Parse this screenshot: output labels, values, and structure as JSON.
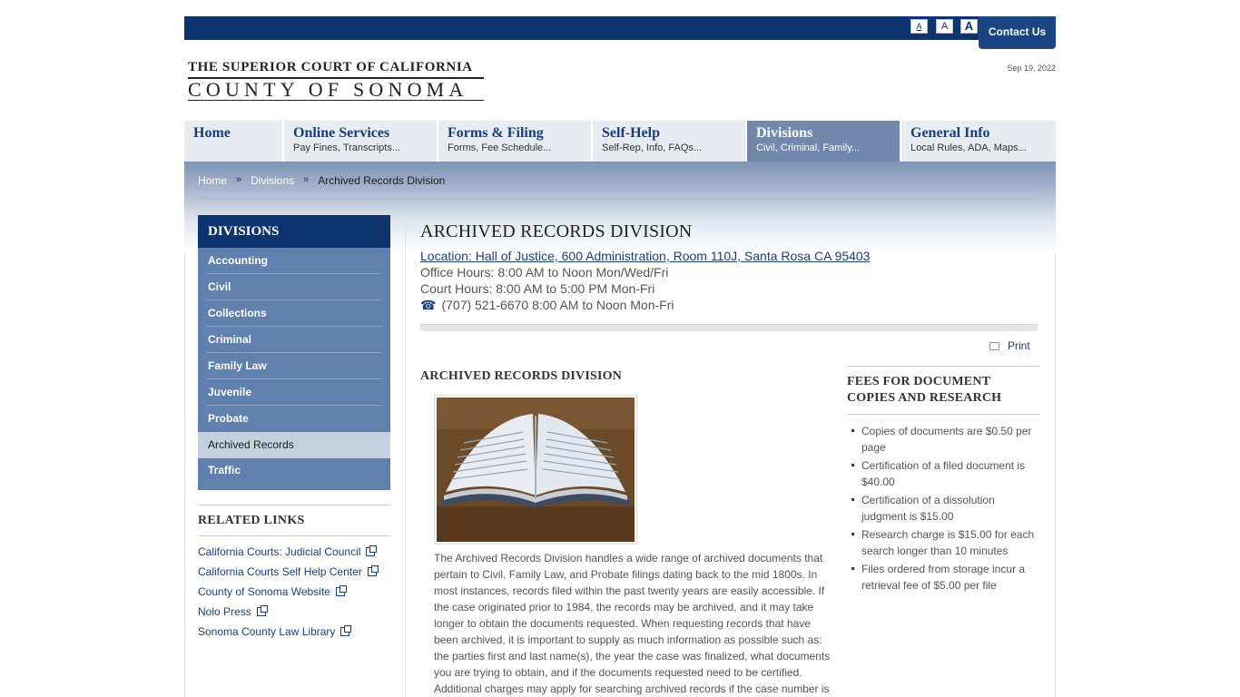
{
  "header": {
    "font_sizes": [
      "A",
      "A",
      "A"
    ],
    "contact_label": "Contact Us",
    "logo_line1": "THE SUPERIOR COURT OF CALIFORNIA",
    "logo_line2": "COUNTY OF SONOMA",
    "date": "Sep 19, 2022"
  },
  "nav": [
    {
      "title": "Home",
      "sub": ""
    },
    {
      "title": "Online Services",
      "sub": "Pay Fines, Transcripts..."
    },
    {
      "title": "Forms & Filing",
      "sub": "Forms, Fee Schedule..."
    },
    {
      "title": "Self-Help",
      "sub": "Self-Rep, Info, FAQs..."
    },
    {
      "title": "Divisions",
      "sub": "Civil, Criminal, Family..."
    },
    {
      "title": "General Info",
      "sub": "Local Rules, ADA, Maps..."
    }
  ],
  "breadcrumb": {
    "home": "Home",
    "sep": "»",
    "divisions": "Divisions",
    "current": "Archived Records Division"
  },
  "sidebar": {
    "heading": "DIVISIONS",
    "items": [
      "Accounting",
      "Civil",
      "Collections",
      "Criminal",
      "Family Law",
      "Juvenile",
      "Probate",
      "Archived Records",
      "Traffic"
    ]
  },
  "related": {
    "heading": "RELATED LINKS",
    "links": [
      "California Courts: Judicial Council",
      "California Courts Self Help Center",
      "County of Sonoma Website",
      "Nolo Press",
      "Sonoma County Law Library"
    ]
  },
  "main": {
    "title": "ARCHIVED RECORDS DIVISION",
    "location": "Location: Hall of Justice, 600 Administration, Room 110J, Santa Rosa CA 95403",
    "office_hours": "Office Hours: 8:00 AM to Noon Mon/Wed/Fri",
    "court_hours": "Court Hours: 8:00 AM to 5:00 PM Mon-Fri",
    "phone": "(707) 521-6670 8:00 AM to Noon Mon-Fri",
    "print_label": "Print",
    "content_title": "ARCHIVED RECORDS DIVISION",
    "paragraph": "The Archived Records Division handles a wide range of archived documents that pertain to Civil, Family Law, and Probate filings dating back to the mid 1800s. In most instances, records filed within the past twenty years are easily accessible. If the case originated prior to 1984, the records may be archived, and it may take longer to obtain the documents requested. When requesting records that have been archived, it is important to supply as much information as possible such as: the parties first and last name(s), the year the case was finalized, what documents you are trying to obtain, and if the documents requested need to be certified. Additional charges may apply for searching archived records if the case number is"
  },
  "fees": {
    "heading": "FEES FOR DOCUMENT COPIES AND RESEARCH",
    "items": [
      "Copies of documents are $0.50 per page",
      "Certification of a filed document is $40.00",
      "Certification of a dissolution judgment is $15.00",
      "Research charge is $15.00 for each search longer than 10 minutes",
      "Files ordered from storage incur a retrieval fee of $5.00 per file"
    ]
  },
  "colors": {
    "brand_navy": "#0e3470",
    "sidebar_blue": "#6080ad",
    "nav_active": "#7289ad"
  }
}
